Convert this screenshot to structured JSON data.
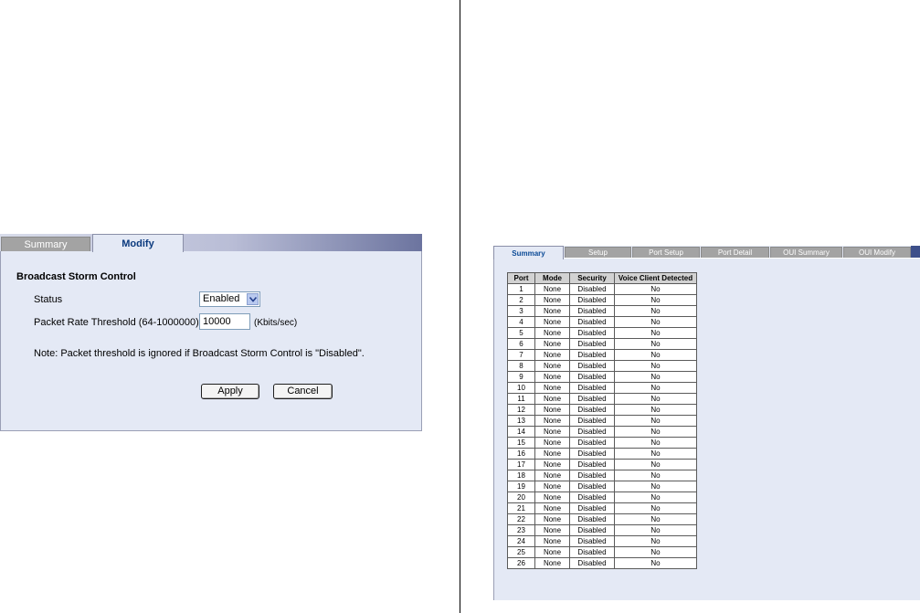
{
  "left": {
    "tabs": [
      {
        "label": "Summary",
        "active": false
      },
      {
        "label": "Modify",
        "active": true
      }
    ],
    "section_title": "Broadcast Storm Control",
    "status_label": "Status",
    "status_value": "Enabled",
    "threshold_label": "Packet Rate Threshold (64-1000000)",
    "threshold_value": "10000",
    "units": "(Kbits/sec)",
    "note": "Note: Packet threshold is ignored if Broadcast Storm Control is \"Disabled\".",
    "apply_label": "Apply",
    "cancel_label": "Cancel"
  },
  "right": {
    "tabs": [
      {
        "label": "Summary",
        "active": true
      },
      {
        "label": "Setup",
        "active": false
      },
      {
        "label": "Port Setup",
        "active": false
      },
      {
        "label": "Port Detail",
        "active": false
      },
      {
        "label": "OUI Summary",
        "active": false
      },
      {
        "label": "OUI Modify",
        "active": false
      }
    ],
    "table": {
      "headers": [
        "Port",
        "Mode",
        "Security",
        "Voice Client Detected"
      ],
      "rows": [
        [
          "1",
          "None",
          "Disabled",
          "No"
        ],
        [
          "2",
          "None",
          "Disabled",
          "No"
        ],
        [
          "3",
          "None",
          "Disabled",
          "No"
        ],
        [
          "4",
          "None",
          "Disabled",
          "No"
        ],
        [
          "5",
          "None",
          "Disabled",
          "No"
        ],
        [
          "6",
          "None",
          "Disabled",
          "No"
        ],
        [
          "7",
          "None",
          "Disabled",
          "No"
        ],
        [
          "8",
          "None",
          "Disabled",
          "No"
        ],
        [
          "9",
          "None",
          "Disabled",
          "No"
        ],
        [
          "10",
          "None",
          "Disabled",
          "No"
        ],
        [
          "11",
          "None",
          "Disabled",
          "No"
        ],
        [
          "12",
          "None",
          "Disabled",
          "No"
        ],
        [
          "13",
          "None",
          "Disabled",
          "No"
        ],
        [
          "14",
          "None",
          "Disabled",
          "No"
        ],
        [
          "15",
          "None",
          "Disabled",
          "No"
        ],
        [
          "16",
          "None",
          "Disabled",
          "No"
        ],
        [
          "17",
          "None",
          "Disabled",
          "No"
        ],
        [
          "18",
          "None",
          "Disabled",
          "No"
        ],
        [
          "19",
          "None",
          "Disabled",
          "No"
        ],
        [
          "20",
          "None",
          "Disabled",
          "No"
        ],
        [
          "21",
          "None",
          "Disabled",
          "No"
        ],
        [
          "22",
          "None",
          "Disabled",
          "No"
        ],
        [
          "23",
          "None",
          "Disabled",
          "No"
        ],
        [
          "24",
          "None",
          "Disabled",
          "No"
        ],
        [
          "25",
          "None",
          "Disabled",
          "No"
        ],
        [
          "26",
          "None",
          "Disabled",
          "No"
        ]
      ]
    }
  },
  "colors": {
    "panel_bg": "#e4e9f5",
    "inactive_tab": "#a3a3a3",
    "active_tab_text": "#0b3a7e",
    "tabbar_accent": "#3d4f8a"
  }
}
